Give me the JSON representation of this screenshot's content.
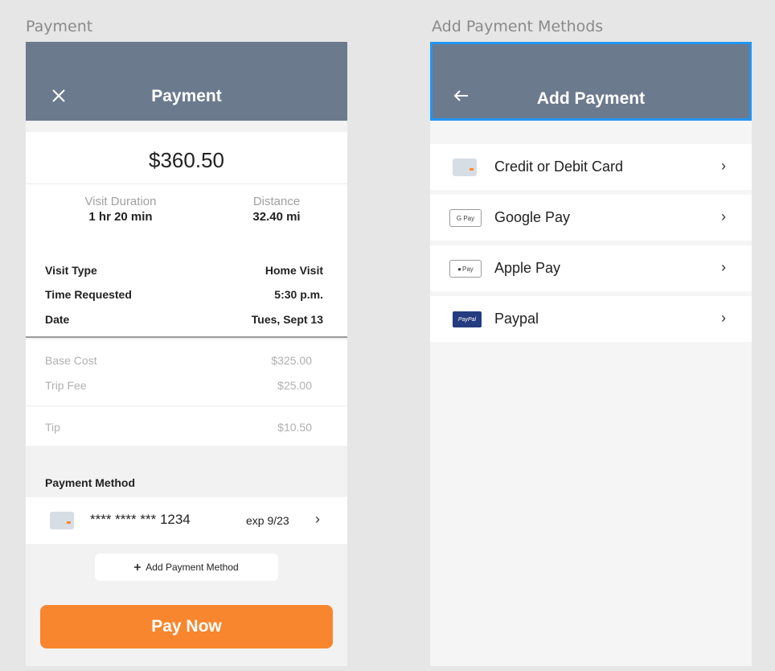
{
  "artboards": {
    "left_label": "Payment",
    "right_label": "Add Payment Methods"
  },
  "payment": {
    "title": "Payment",
    "amount": "$360.50",
    "stats": [
      {
        "label": "Visit Duration",
        "value": "1 hr 20 min"
      },
      {
        "label": "Distance",
        "value": "32.40 mi"
      }
    ],
    "details": [
      {
        "label": "Visit Type",
        "value": "Home Visit"
      },
      {
        "label": "Time Requested",
        "value": "5:30 p.m."
      },
      {
        "label": "Date",
        "value": "Tues, Sept 13"
      }
    ],
    "costs": [
      {
        "label": "Base Cost",
        "value": "$325.00"
      },
      {
        "label": "Trip Fee",
        "value": "$25.00"
      },
      {
        "label": "Tip",
        "value": "$10.50"
      }
    ],
    "payment_method_heading": "Payment Method",
    "selected_method": {
      "number": "**** **** *** 1234",
      "exp": "exp 9/23"
    },
    "add_method_label": "Add Payment Method",
    "pay_now_label": "Pay Now"
  },
  "add_payment": {
    "title": "Add Payment",
    "methods": [
      {
        "label": "Credit or Debit Card",
        "icon": "credit-card-icon"
      },
      {
        "label": "Google Pay",
        "icon": "google-pay-icon",
        "badge": "G Pay"
      },
      {
        "label": "Apple Pay",
        "icon": "apple-pay-icon",
        "badge": "Pay"
      },
      {
        "label": "Paypal",
        "icon": "paypal-icon",
        "badge": "PayPal"
      }
    ]
  },
  "colors": {
    "app_bar": "#6c7a8e",
    "accent": "#f7862e",
    "selection": "#2196f3"
  }
}
